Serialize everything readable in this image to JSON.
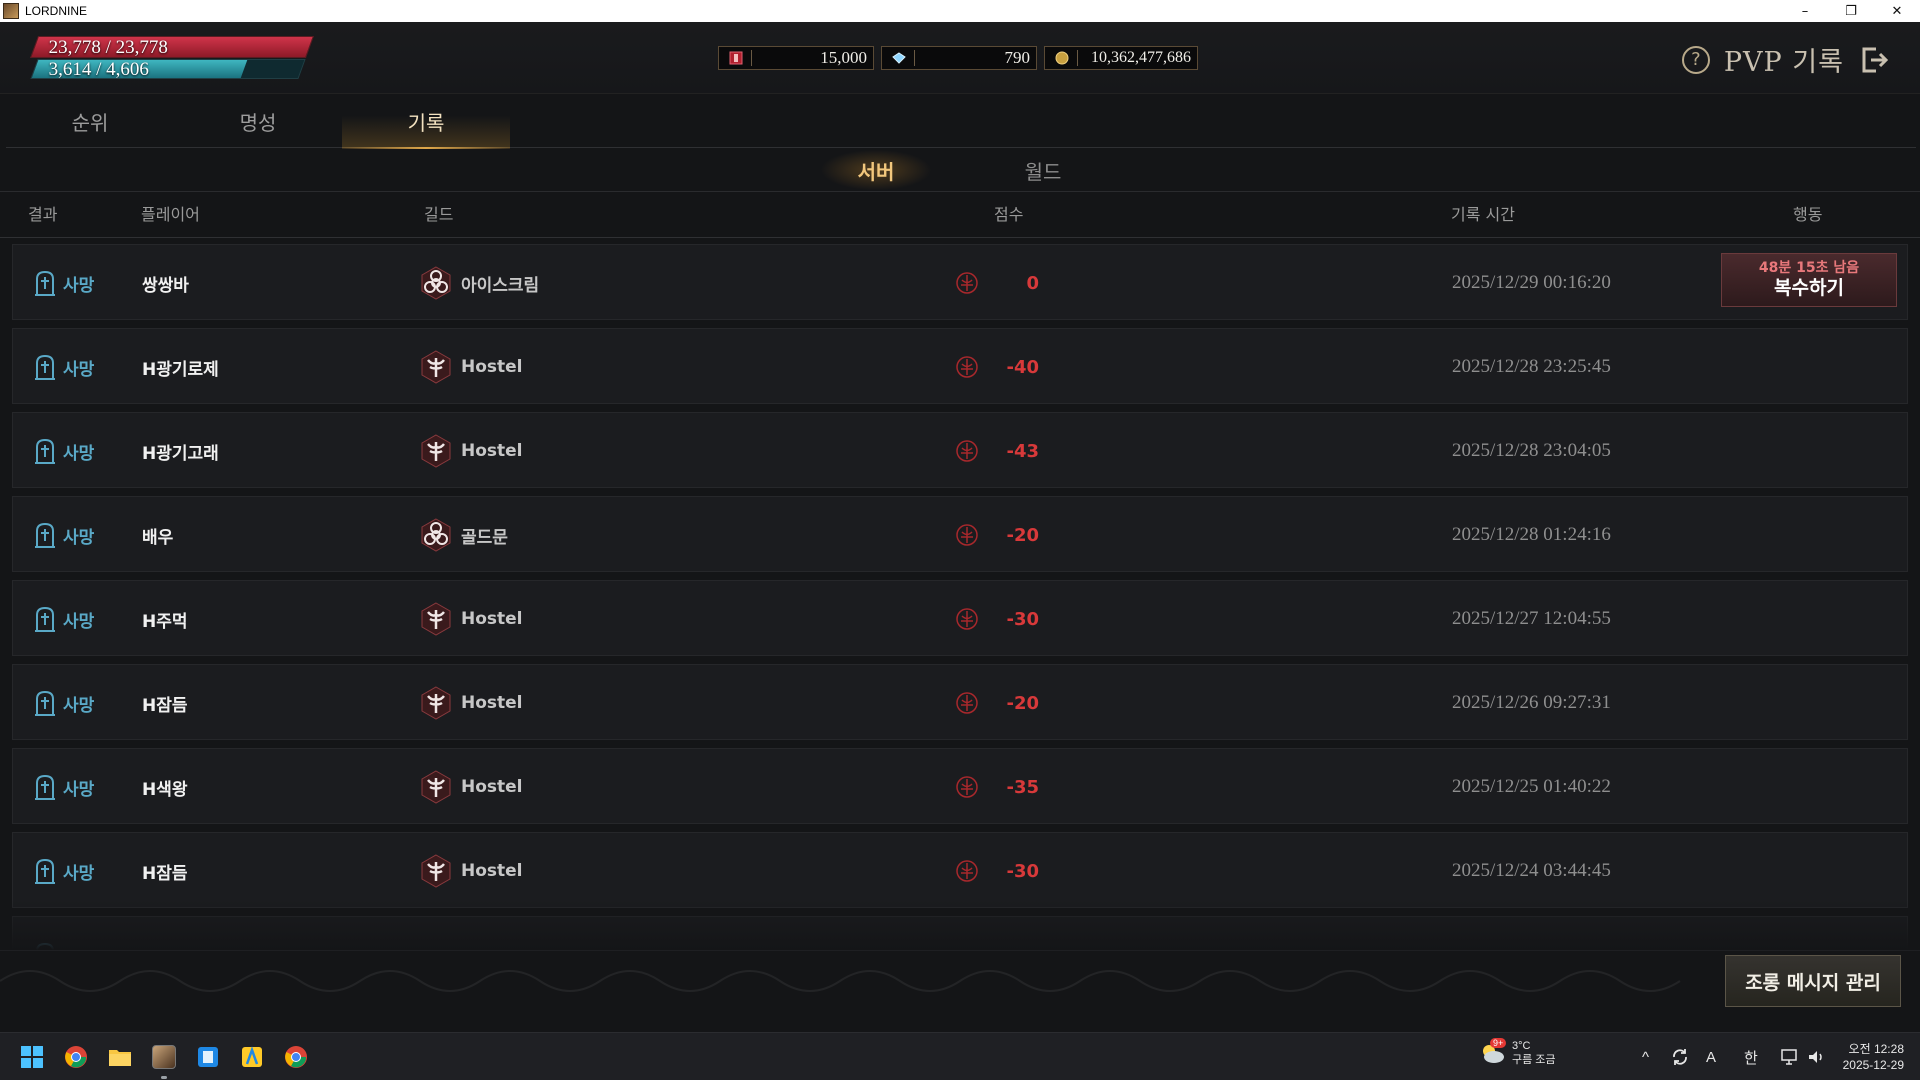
{
  "window": {
    "title": "LORDNINE",
    "minimize": "–",
    "restore": "❐",
    "close": "✕"
  },
  "hud": {
    "hp_text": "23,778 / 23,778",
    "hp_fraction": 1.0,
    "mp_text": "3,614 / 4,606",
    "mp_fraction": 0.785,
    "currency": [
      {
        "icon": "red-ticket-icon",
        "value": "15,000"
      },
      {
        "icon": "diamond-icon",
        "value": "790"
      },
      {
        "icon": "gold-coin-icon",
        "value": "10,362,477,686"
      }
    ],
    "title": "PVP 기록",
    "help": "?"
  },
  "tabs": [
    {
      "label": "순위",
      "active": false
    },
    {
      "label": "명성",
      "active": false
    },
    {
      "label": "기록",
      "active": true
    }
  ],
  "subtabs": [
    {
      "label": "서버",
      "active": true
    },
    {
      "label": "월드",
      "active": false
    }
  ],
  "table": {
    "headers": {
      "result": "결과",
      "player": "플레이어",
      "guild": "길드",
      "score": "점수",
      "time": "기록 시간",
      "action": "행동"
    },
    "rows": [
      {
        "result": "사망",
        "player": "쌍쌍바",
        "guild": "아이스크림",
        "emblem": "biohazard",
        "score": "0",
        "time": "2025/12/29 00:16:20"
      },
      {
        "result": "사망",
        "player": "H광기로제",
        "guild": "Hostel",
        "emblem": "winged",
        "score": "-40",
        "time": "2025/12/28 23:25:45"
      },
      {
        "result": "사망",
        "player": "H광기고래",
        "guild": "Hostel",
        "emblem": "winged",
        "score": "-43",
        "time": "2025/12/28 23:04:05"
      },
      {
        "result": "사망",
        "player": "배우",
        "guild": "골드문",
        "emblem": "biohazard",
        "score": "-20",
        "time": "2025/12/28 01:24:16"
      },
      {
        "result": "사망",
        "player": "H주먹",
        "guild": "Hostel",
        "emblem": "winged",
        "score": "-30",
        "time": "2025/12/27 12:04:55"
      },
      {
        "result": "사망",
        "player": "H잠듬",
        "guild": "Hostel",
        "emblem": "winged",
        "score": "-20",
        "time": "2025/12/26 09:27:31"
      },
      {
        "result": "사망",
        "player": "H색왕",
        "guild": "Hostel",
        "emblem": "winged",
        "score": "-35",
        "time": "2025/12/25 01:40:22"
      },
      {
        "result": "사망",
        "player": "H잠듬",
        "guild": "Hostel",
        "emblem": "winged",
        "score": "-30",
        "time": "2025/12/24 03:44:45"
      }
    ],
    "revenge": {
      "remaining": "48분 15초 남음",
      "label": "복수하기"
    }
  },
  "footer": {
    "taunt_button": "조롱 메시지 관리"
  },
  "taskbar": {
    "apps": [
      "windows-start-icon",
      "chrome-icon",
      "file-explorer-icon",
      "lordnine-game-icon",
      "app-blue-icon",
      "app-yellow-icon",
      "chrome-icon"
    ],
    "weather": {
      "badge": "9+",
      "temp": "3°C",
      "desc": "구름 조금"
    },
    "tray": {
      "chevron": "^",
      "ime_a": "A",
      "ime_han": "한"
    },
    "clock": {
      "time": "오전 12:28",
      "date": "2025-12-29"
    }
  },
  "colors": {
    "accent_gold": "#f2c77d",
    "score_red": "#d8393a",
    "result_blue": "#5aa9c7",
    "hp_red": "#d0344a",
    "mp_teal": "#3fb6c0"
  }
}
